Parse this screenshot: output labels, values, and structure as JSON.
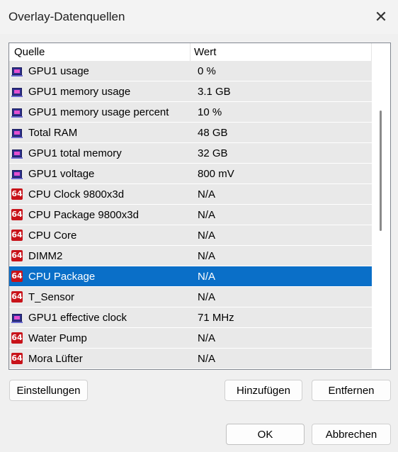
{
  "window": {
    "title": "Overlay-Datenquellen"
  },
  "list": {
    "columns": [
      "Quelle",
      "Wert"
    ],
    "rows": [
      {
        "icon": "gpu",
        "source": "GPU1 usage",
        "value": "0 %"
      },
      {
        "icon": "gpu",
        "source": "GPU1 memory usage",
        "value": "3.1 GB"
      },
      {
        "icon": "gpu",
        "source": "GPU1 memory usage percent",
        "value": "10 %"
      },
      {
        "icon": "gpu",
        "source": "Total RAM",
        "value": "48 GB"
      },
      {
        "icon": "gpu",
        "source": "GPU1 total memory",
        "value": "32 GB"
      },
      {
        "icon": "gpu",
        "source": "GPU1 voltage",
        "value": "800 mV"
      },
      {
        "icon": "aida64",
        "source": "CPU Clock 9800x3d",
        "value": "N/A"
      },
      {
        "icon": "aida64",
        "source": "CPU Package 9800x3d",
        "value": "N/A"
      },
      {
        "icon": "aida64",
        "source": "CPU Core",
        "value": "N/A"
      },
      {
        "icon": "aida64",
        "source": "DIMM2",
        "value": "N/A"
      },
      {
        "icon": "aida64",
        "source": "CPU Package",
        "value": "N/A",
        "selected": true
      },
      {
        "icon": "aida64",
        "source": "T_Sensor",
        "value": "N/A"
      },
      {
        "icon": "gpu",
        "source": "GPU1 effective clock",
        "value": "71 MHz"
      },
      {
        "icon": "aida64",
        "source": "Water Pump",
        "value": "N/A"
      },
      {
        "icon": "aida64",
        "source": "Mora Lüfter",
        "value": "N/A"
      }
    ],
    "icon_text": "64"
  },
  "buttons": {
    "settings": "Einstellungen",
    "add": "Hinzufügen",
    "remove": "Entfernen",
    "ok": "OK",
    "cancel": "Abbrechen"
  },
  "colors": {
    "selection": "#0a6fc8",
    "row_bg": "#e9e9e9",
    "aida_icon": "#c8131a"
  }
}
